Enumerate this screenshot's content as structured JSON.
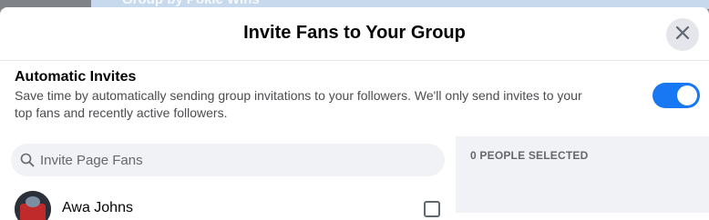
{
  "background": {
    "group_name": "Group by Pokie Wins"
  },
  "dialog": {
    "title": "Invite Fans to Your Group",
    "close_icon": "close-icon"
  },
  "automatic_invites": {
    "title": "Automatic Invites",
    "description_line1": "Save time by automatically sending group invitations to your followers. We'll only send invites to your",
    "description_line2": "top fans and recently active followers.",
    "enabled": true
  },
  "search": {
    "placeholder": "Invite Page Fans",
    "icon": "search-icon"
  },
  "selection": {
    "count_label": "0 PEOPLE SELECTED"
  },
  "fans": [
    {
      "name": "Awa Johns",
      "checked": false
    }
  ],
  "colors": {
    "accent": "#1877f2",
    "panel_bg": "#f0f2f5",
    "muted_text": "#65676b"
  }
}
